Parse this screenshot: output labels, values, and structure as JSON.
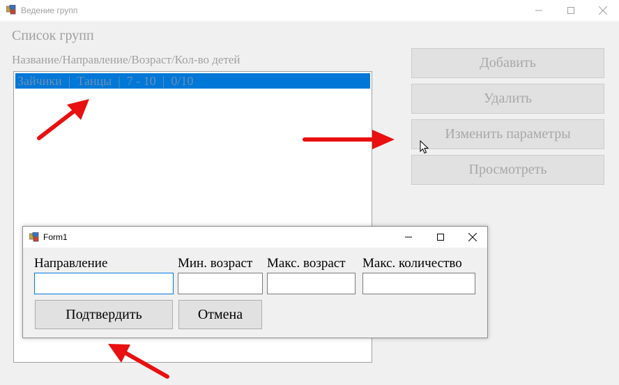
{
  "main_window": {
    "title": "Ведение групп",
    "list_title": "Список групп",
    "list_header": "Название/Направление/Возраст/Кол-во детей",
    "groups": [
      {
        "text": "Зайчики  |  Танцы  |  7 - 10  |  0/10"
      }
    ],
    "buttons": {
      "add": "Добавить",
      "delete": "Удалить",
      "edit": "Изменить параметры",
      "view": "Просмотреть"
    }
  },
  "dialog": {
    "title": "Form1",
    "labels": {
      "direction": "Направление",
      "min_age": "Мин. возраст",
      "max_age": "Макс. возраст",
      "max_count": "Макс. количество"
    },
    "inputs": {
      "direction": "",
      "min_age": "",
      "max_age": "",
      "max_count": ""
    },
    "buttons": {
      "confirm": "Подтвердить",
      "cancel": "Отмена"
    }
  },
  "colors": {
    "selection": "#0078d7",
    "arrow": "#e81010",
    "disabled_text": "#a0a0a0"
  },
  "icons": [
    "app-icon",
    "minimize-icon",
    "maximize-icon",
    "close-icon",
    "mouse-cursor-icon",
    "red-arrow-icon"
  ]
}
